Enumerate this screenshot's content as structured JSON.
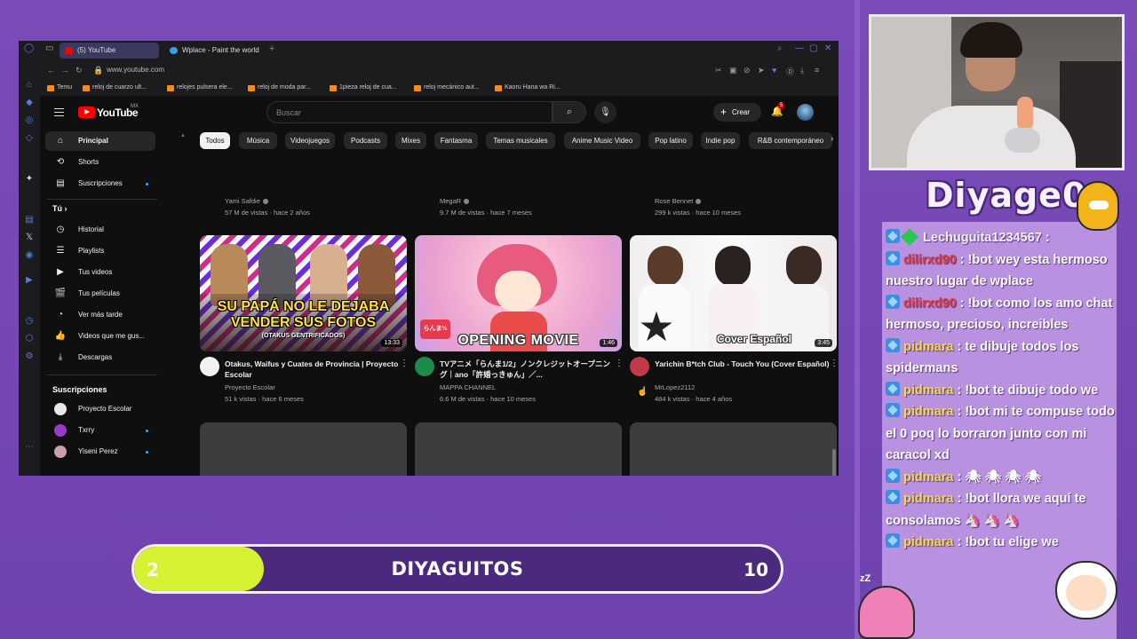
{
  "browser": {
    "tabs": [
      {
        "label": "(5) YouTube",
        "active": true,
        "favicon_color": "#ff0000"
      },
      {
        "label": "Wplace - Paint the world",
        "active": false,
        "favicon_color": "#3aa0e8"
      }
    ],
    "url": "www.youtube.com",
    "bookmarks": [
      "Temu",
      "reloj de cuarzo ult...",
      "relojes pulsera ele...",
      "reloj de moda par...",
      "1pieza reloj de cua...",
      "reloj mecánico aut...",
      "Kaoru Hana wa Ri..."
    ]
  },
  "youtube": {
    "logo_text": "YouTube",
    "region": "MX",
    "search_placeholder": "Buscar",
    "create_label": "Crear",
    "notification_count": "5",
    "sidebar": {
      "main": [
        {
          "label": "Principal",
          "icon": "home-icon",
          "active": true
        },
        {
          "label": "Shorts",
          "icon": "shorts-icon"
        },
        {
          "label": "Suscripciones",
          "icon": "subscriptions-icon",
          "dot": true
        }
      ],
      "you_heading": "Tú",
      "you": [
        {
          "label": "Historial",
          "icon": "history-icon"
        },
        {
          "label": "Playlists",
          "icon": "playlists-icon"
        },
        {
          "label": "Tus videos",
          "icon": "your-videos-icon"
        },
        {
          "label": "Tus películas",
          "icon": "movies-icon"
        },
        {
          "label": "Ver más tarde",
          "icon": "watch-later-icon"
        },
        {
          "label": "Videos que me gus...",
          "icon": "like-icon"
        },
        {
          "label": "Descargas",
          "icon": "download-icon"
        }
      ],
      "subs_heading": "Suscripciones",
      "subs": [
        {
          "label": "Proyecto Escolar",
          "color": "#e8e8e8"
        },
        {
          "label": "Txrry",
          "color": "#9a3ac8",
          "dot": true
        },
        {
          "label": "Yiseni Perez",
          "color": "#c8a0b0",
          "dot": true
        }
      ]
    },
    "chips": [
      "Todos",
      "Música",
      "Videojuegos",
      "Podcasts",
      "Mixes",
      "Fantasma",
      "Temas musicales",
      "Anime Music Video",
      "Pop latino",
      "Indie pop",
      "R&B contemporáneo"
    ],
    "prev_row": [
      {
        "channel": "Yami Safdie",
        "stats": "57 M de vistas · hace 2 años"
      },
      {
        "channel": "MegaR",
        "stats": "9.7 M de vistas · hace 7 meses"
      },
      {
        "channel": "Rose Bennet",
        "stats": "299 k vistas · hace 10 meses"
      }
    ],
    "videos": [
      {
        "title": "Otakus, Waifus y Cuates de Provincia | Proyecto Escolar",
        "channel": "Proyecto Escolar",
        "stats": "51 k vistas · hace 6 meses",
        "duration": "13:33",
        "thumb_text_1": "SU PAPÁ NO LE DEJABA VENDER SUS FOTOS",
        "thumb_text_2": "(OTAKUS GENTRIFICADOS)",
        "avatar_color": "#f2f2f2"
      },
      {
        "title": "TVアニメ「らんま1/2」ノンクレジットオープニング｜ano「許婚っきゅん」／...",
        "channel": "MAPPA CHANNEL",
        "stats": "6.6 M de vistas · hace 10 meses",
        "duration": "1:46",
        "thumb_text_1": "OPENING MOVIE",
        "thumb_logo": "らんま½",
        "avatar_color": "#1b8a4a"
      },
      {
        "title": "Yarichin B*tch Club - Touch You (Cover Español)",
        "channel": "MrLopez2112",
        "stats": "484 k vistas · hace 4 años",
        "duration": "3:45",
        "thumb_text_1": "Cover Español",
        "avatar_color": "#c23a4a"
      }
    ]
  },
  "chat": {
    "title": "Diyage0",
    "messages": [
      {
        "user": "Lechuguita1234567",
        "user_color": "#f2f2f2",
        "text": ""
      },
      {
        "user": "dilirxd90",
        "user_color": "#e33b3b",
        "text": "!bot wey esta hermoso nuestro lugar de wplace"
      },
      {
        "user": "dilirxd90",
        "user_color": "#e33b3b",
        "text": "!bot como los amo chat hermoso, precioso, increibles"
      },
      {
        "user": "pidmara",
        "user_color": "#f5d84a",
        "text": "te dibuje todos los spidermans"
      },
      {
        "user": "pidmara",
        "user_color": "#f5d84a",
        "text": "!bot te dibuje todo we"
      },
      {
        "user": "pidmara",
        "user_color": "#f5d84a",
        "text": "!bot mi te compuse todo el 0 poq lo borraron junto con mi caracol xd"
      },
      {
        "user": "pidmara",
        "user_color": "#f5d84a",
        "text": "🕷 🕷 🕷 🕷"
      },
      {
        "user": "pidmara",
        "user_color": "#f5d84a",
        "text": "!bot llora we aquí te consolamos 🦄 🦄 🦄"
      },
      {
        "user": "pidmara",
        "user_color": "#f5d84a",
        "text": "!bot tu elige we"
      }
    ]
  },
  "goal": {
    "label": "DIYAGUITOS",
    "current": "2",
    "max": "10",
    "progress_fraction": 0.2,
    "fill_color": "#d6f232",
    "bg_color": "#4b2a7e"
  }
}
